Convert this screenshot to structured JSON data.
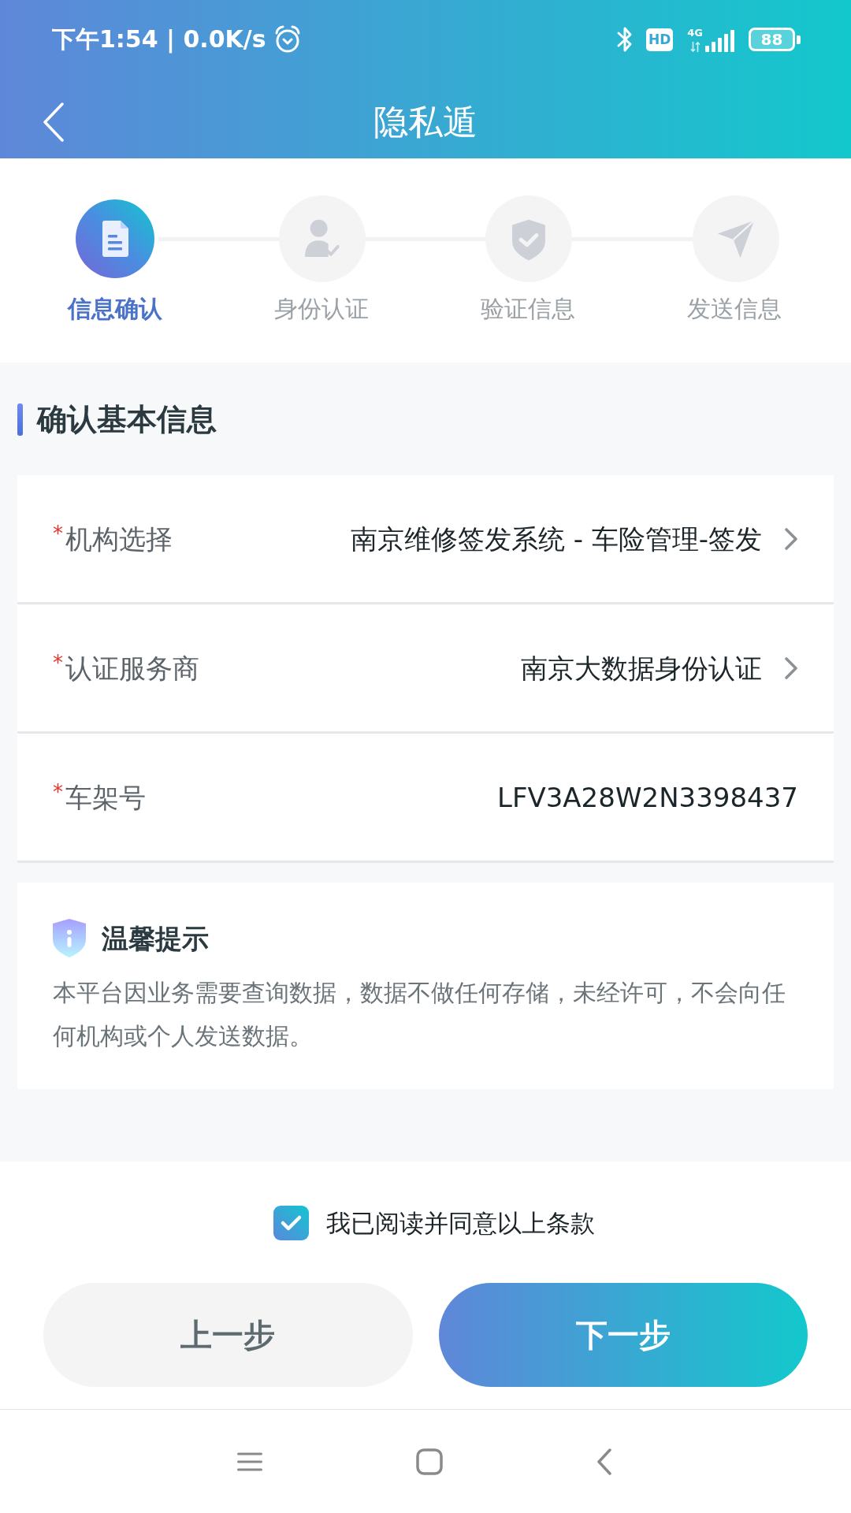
{
  "status_bar": {
    "time": "下午1:54 | 0.0K/s",
    "hd": "HD",
    "network": "4G",
    "battery": "88"
  },
  "header": {
    "title": "隐私遁"
  },
  "steps": [
    {
      "label": "信息确认",
      "selected": true
    },
    {
      "label": "身份认证",
      "selected": false
    },
    {
      "label": "验证信息",
      "selected": false
    },
    {
      "label": "发送信息",
      "selected": false
    }
  ],
  "section": {
    "title": "确认基本信息"
  },
  "fields": [
    {
      "kind": "select",
      "mark": "*",
      "label": "机构选择",
      "value": "南京维修签发系统 - 车险管理-签发"
    },
    {
      "kind": "select",
      "mark": "*",
      "label": "认证服务商",
      "value": "南京大数据身份认证"
    },
    {
      "kind": "text",
      "mark": "*",
      "label": "车架号",
      "value": "LFV3A28W2N3398437"
    }
  ],
  "notice": {
    "title": "温馨提示",
    "text": "本平台因业务需要查询数据，数据不做任何存储，未经许可，不会向任何机构或个人发送数据。"
  },
  "agreement": {
    "label": "我已阅读并同意以上条款",
    "checked": true
  },
  "buttons": [
    {
      "kind": "secondary",
      "label": "上一步"
    },
    {
      "kind": "primary",
      "label": "下一步"
    }
  ]
}
